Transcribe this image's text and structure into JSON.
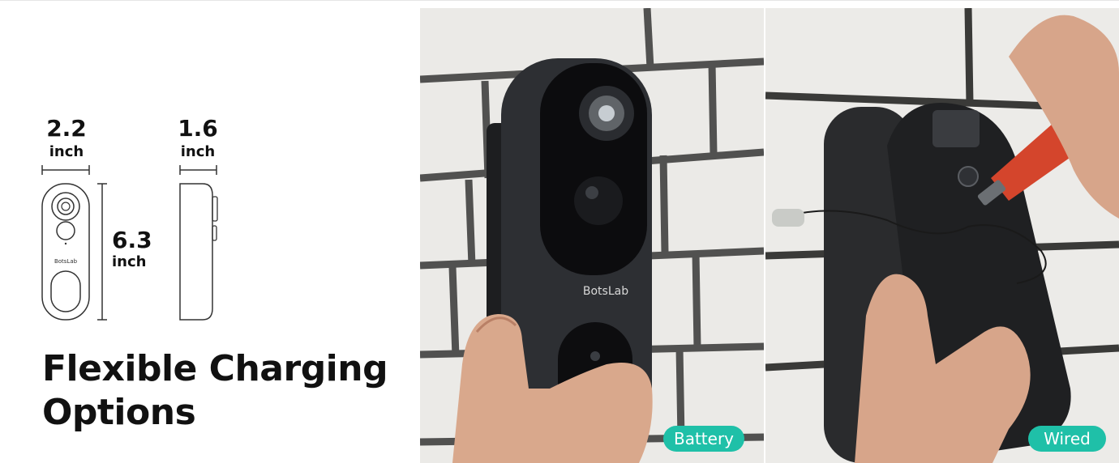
{
  "dimensions": {
    "width": {
      "value": "2.2",
      "unit": "inch"
    },
    "depth": {
      "value": "1.6",
      "unit": "inch"
    },
    "height": {
      "value": "6.3",
      "unit": "inch"
    }
  },
  "device_logo": "BotsLab",
  "photo_logo": "BotsLab",
  "headline": {
    "line1": "Flexible Charging",
    "line2": "Options"
  },
  "badges": {
    "battery": "Battery",
    "wired": "Wired"
  },
  "colors": {
    "badge": "#1fc0a8",
    "text": "#111111",
    "wall": "#ecebe7",
    "device": "#2b2d30"
  },
  "icons": {
    "power": "power-icon",
    "screwdriver": "screwdriver-icon",
    "doorbell": "doorbell-icon"
  }
}
